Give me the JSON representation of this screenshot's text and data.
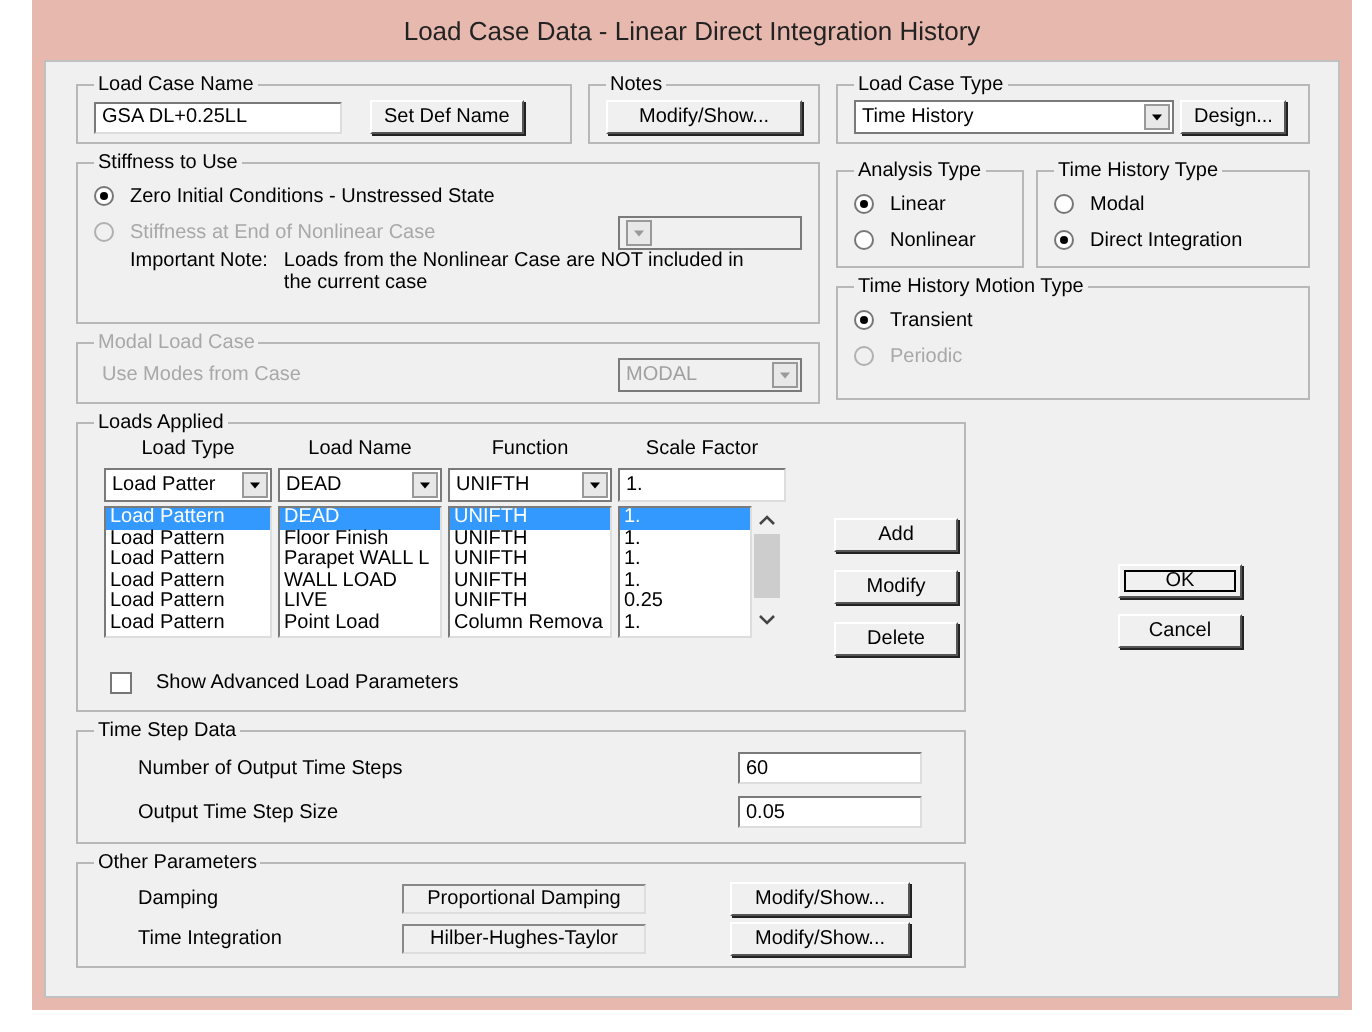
{
  "window": {
    "title": "Load Case Data - Linear Direct Integration History"
  },
  "load_case_name": {
    "label": "Load Case Name",
    "value": "GSA DL+0.25LL",
    "button": "Set Def Name"
  },
  "notes": {
    "label": "Notes",
    "button": "Modify/Show..."
  },
  "load_case_type": {
    "label": "Load Case Type",
    "value": "Time History",
    "button": "Design..."
  },
  "stiffness": {
    "label": "Stiffness to Use",
    "options": [
      {
        "label": "Zero Initial Conditions - Unstressed State",
        "selected": true,
        "disabled": false
      },
      {
        "label": "Stiffness at End of Nonlinear Case",
        "selected": false,
        "disabled": true
      }
    ],
    "note_label": "Important Note:",
    "note": "Loads from the Nonlinear Case are NOT included in the current case"
  },
  "modal_load_case": {
    "label": "Modal Load Case",
    "disabled": true,
    "field_label": "Use Modes from Case",
    "value": "MODAL"
  },
  "analysis_type": {
    "label": "Analysis Type",
    "options": [
      {
        "label": "Linear",
        "selected": true,
        "disabled": false
      },
      {
        "label": "Nonlinear",
        "selected": false,
        "disabled": false
      }
    ]
  },
  "time_history_type": {
    "label": "Time History Type",
    "options": [
      {
        "label": "Modal",
        "selected": false,
        "disabled": false
      },
      {
        "label": "Direct Integration",
        "selected": true,
        "disabled": false
      }
    ]
  },
  "motion_type": {
    "label": "Time History Motion Type",
    "options": [
      {
        "label": "Transient",
        "selected": true,
        "disabled": false
      },
      {
        "label": "Periodic",
        "selected": false,
        "disabled": true
      }
    ]
  },
  "loads_applied": {
    "label": "Loads Applied",
    "columns": [
      "Load Type",
      "Load Name",
      "Function",
      "Scale Factor"
    ],
    "inputs": [
      "Load Patter",
      "DEAD",
      "UNIFTH",
      "1."
    ],
    "rows": [
      {
        "cells": [
          "Load Pattern",
          "DEAD",
          "UNIFTH",
          "1."
        ],
        "selected": true
      },
      {
        "cells": [
          "Load Pattern",
          "Floor Finish",
          "UNIFTH",
          "1."
        ],
        "selected": false
      },
      {
        "cells": [
          "Load Pattern",
          "Parapet WALL L",
          "UNIFTH",
          "1."
        ],
        "selected": false
      },
      {
        "cells": [
          "Load Pattern",
          "WALL LOAD",
          "UNIFTH",
          "1."
        ],
        "selected": false
      },
      {
        "cells": [
          "Load Pattern",
          "LIVE",
          "UNIFTH",
          "0.25"
        ],
        "selected": false
      },
      {
        "cells": [
          "Load Pattern",
          "Point Load",
          "Column Remova",
          "1."
        ],
        "selected": false
      }
    ],
    "buttons": [
      "Add",
      "Modify",
      "Delete"
    ],
    "advanced": {
      "label": "Show Advanced Load Parameters",
      "checked": false
    }
  },
  "time_step_data": {
    "label": "Time Step Data",
    "fields": [
      {
        "label": "Number of Output Time Steps",
        "value": "60"
      },
      {
        "label": "Output Time Step Size",
        "value": "0.05"
      }
    ]
  },
  "other_parameters": {
    "label": "Other Parameters",
    "rows": [
      {
        "label": "Damping",
        "value": "Proportional Damping",
        "button": "Modify/Show..."
      },
      {
        "label": "Time Integration",
        "value": "Hilber-Hughes-Taylor",
        "button": "Modify/Show..."
      }
    ]
  },
  "buttons": [
    {
      "label": "OK",
      "default": true
    },
    {
      "label": "Cancel",
      "default": false
    }
  ]
}
